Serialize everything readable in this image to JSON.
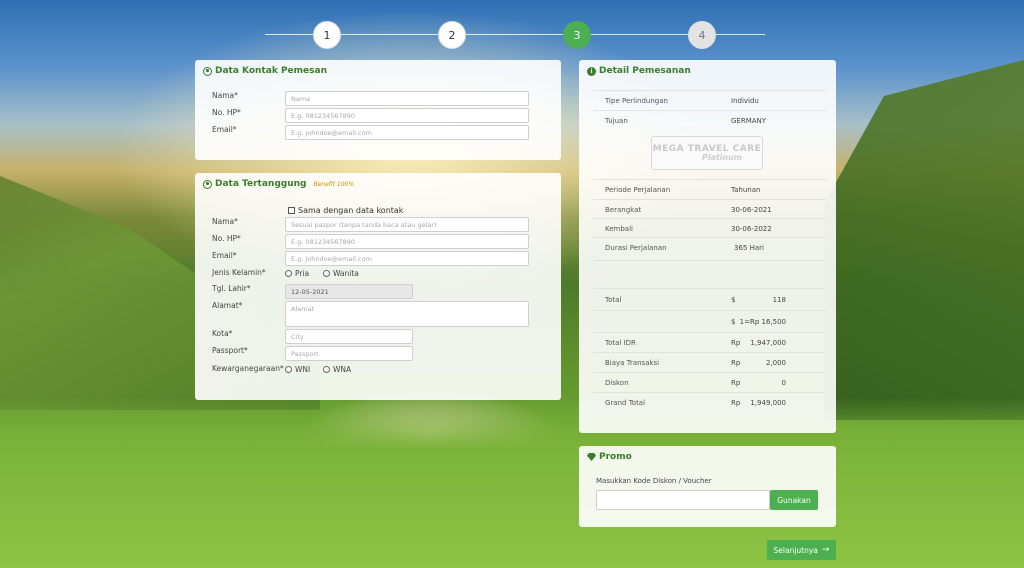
{
  "stepper": {
    "steps": [
      "1",
      "2",
      "3",
      "4"
    ],
    "active_step": "3"
  },
  "contact": {
    "title": "Data Kontak Pemesan",
    "name_label": "Nama*",
    "name_placeholder": "Nama",
    "phone_label": "No. HP*",
    "phone_placeholder": "E.g. 081234567890",
    "email_label": "Email*",
    "email_placeholder": "E.g. johndoe@email.com"
  },
  "insured": {
    "title": "Data Tertanggung",
    "benefit": "Benefit 100%",
    "same_as_contact": "Sama dengan data kontak",
    "name_label": "Nama*",
    "name_placeholder": "Sesuai paspor (tanpa tanda baca atau gelar)",
    "phone_label": "No. HP*",
    "phone_placeholder": "E.g. 081234567890",
    "email_label": "Email*",
    "email_placeholder": "E.g. johndoe@email.com",
    "gender_label": "Jenis Kelamin*",
    "gender_options": [
      "Pria",
      "Wanita"
    ],
    "dob_label": "Tgl. Lahir*",
    "dob_value": "12-05-2021",
    "address_label": "Alamat*",
    "address_placeholder": "Alamat",
    "city_label": "Kota*",
    "city_placeholder": "City",
    "passport_label": "Passport*",
    "passport_placeholder": "Passport",
    "citizenship_label": "Kewarganegaraan*",
    "citizenship_options": [
      "WNI",
      "WNA"
    ]
  },
  "detail": {
    "title": "Detail Pemesanan",
    "rows_top": [
      {
        "k": "Tipe Perlindungan",
        "v": "Individu"
      },
      {
        "k": "Tujuan",
        "v": "GERMANY"
      }
    ],
    "logo_line1": "MEGA TRAVEL CARE",
    "logo_line2": "Platinum",
    "rows_mid": [
      {
        "k": "Periode Perjalanan",
        "v": "Tahunan"
      },
      {
        "k": "Berangkat",
        "v": "30-06-2021"
      },
      {
        "k": "Kembali",
        "v": "30-06-2022"
      },
      {
        "k": "Durasi Perjalanan",
        "v": "365 Hari"
      }
    ],
    "total": {
      "k": "Total",
      "c": "$",
      "a": "118"
    },
    "rate": {
      "c": "$",
      "a": "1=Rp 16,500"
    },
    "rows_bottom": [
      {
        "k": "Total IDR",
        "c": "Rp",
        "a": "1,947,000"
      },
      {
        "k": "Biaya Transaksi",
        "c": "Rp",
        "a": "2,000"
      },
      {
        "k": "Diskon",
        "c": "Rp",
        "a": "0"
      },
      {
        "k": "Grand Total",
        "c": "Rp",
        "a": "1,949,000"
      }
    ]
  },
  "promo": {
    "title": "Promo",
    "label": "Masukkan Kode Diskon / Voucher",
    "apply_label": "Gunakan"
  },
  "next_label": "Selanjutnya",
  "colors": {
    "accent": "#4caf50",
    "title_green": "#3a7d2a"
  }
}
